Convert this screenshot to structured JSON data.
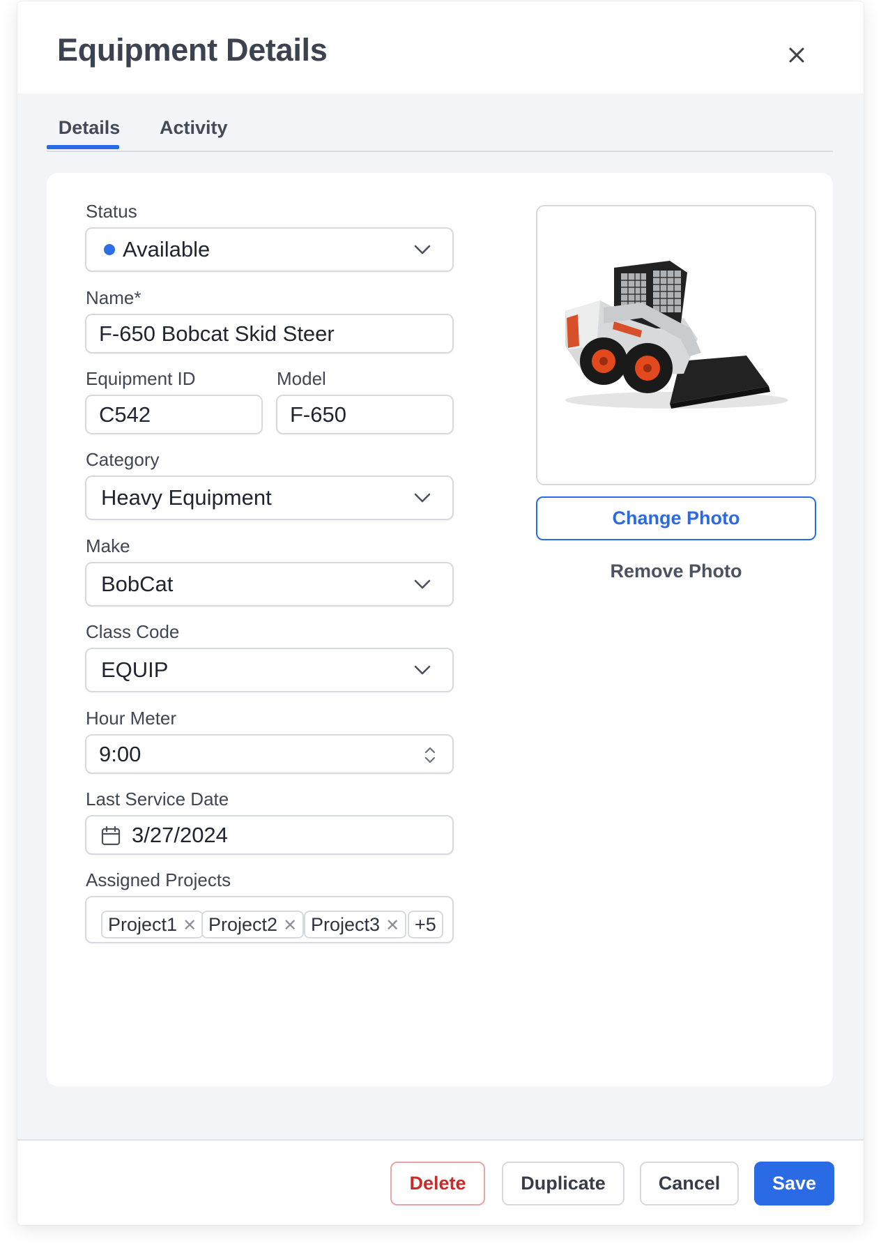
{
  "modal": {
    "title": "Equipment Details"
  },
  "tabs": [
    {
      "label": "Details"
    },
    {
      "label": "Activity"
    }
  ],
  "form": {
    "status": {
      "label": "Status",
      "value": "Available",
      "dot_color": "#2b6ee8"
    },
    "name": {
      "label": "Name*",
      "value": "F-650 Bobcat Skid Steer"
    },
    "equipment_id": {
      "label": "Equipment ID",
      "value": "C542"
    },
    "model": {
      "label": "Model",
      "value": "F-650"
    },
    "category": {
      "label": "Category",
      "value": "Heavy Equipment"
    },
    "make": {
      "label": "Make",
      "value": "BobCat"
    },
    "class_code": {
      "label": "Class Code",
      "value": "EQUIP"
    },
    "hour_meter": {
      "label": "Hour Meter",
      "value": "9:00"
    },
    "last_service_date": {
      "label": "Last Service Date",
      "value": "3/27/2024"
    },
    "assigned_projects": {
      "label": "Assigned Projects",
      "chips": [
        {
          "label": "Project1"
        },
        {
          "label": "Project2"
        },
        {
          "label": "Project3"
        }
      ],
      "more": "+5"
    }
  },
  "photo": {
    "change_label": "Change Photo",
    "remove_label": "Remove Photo"
  },
  "footer": {
    "delete_label": "Delete",
    "duplicate_label": "Duplicate",
    "cancel_label": "Cancel",
    "save_label": "Save"
  },
  "colors": {
    "accent": "#2a6ae5",
    "danger": "#c92b2b"
  }
}
